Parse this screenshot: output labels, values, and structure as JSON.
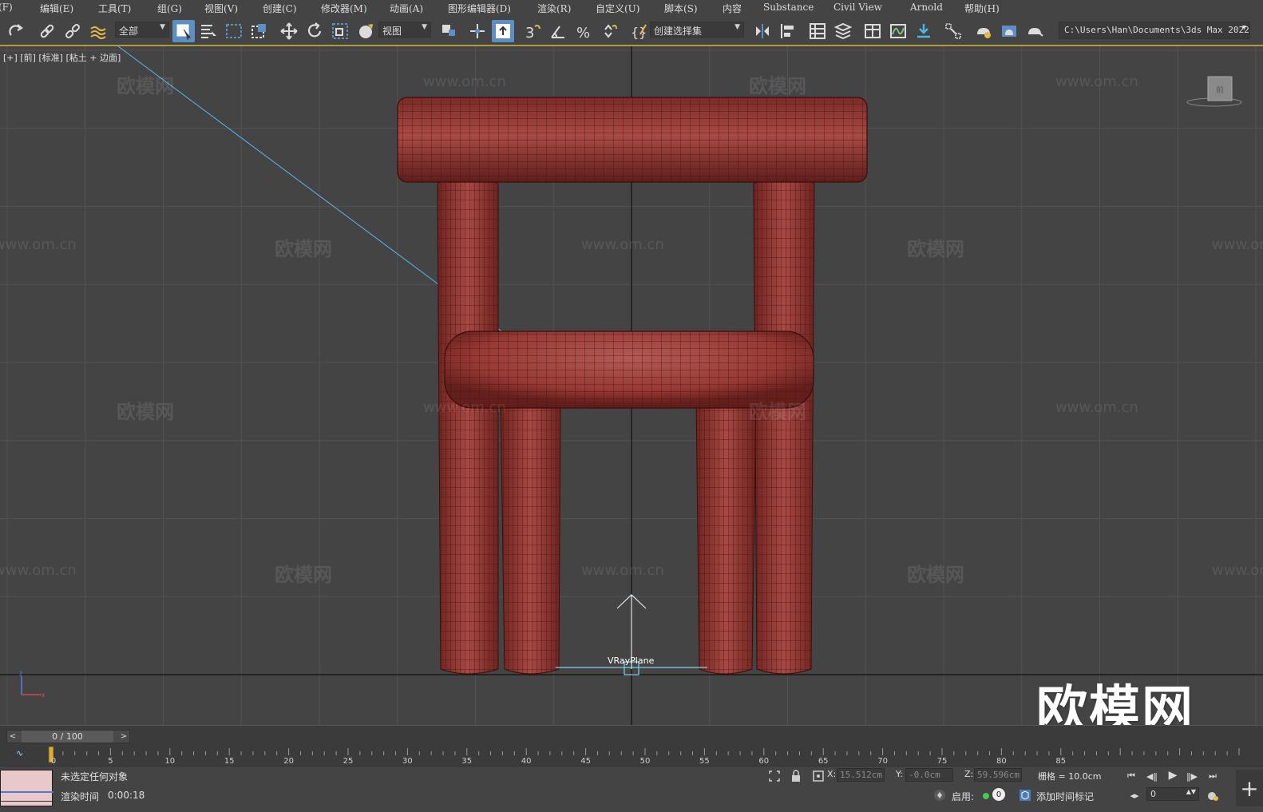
{
  "menu": {
    "items": [
      "(F)",
      "编辑(E)",
      "工具(T)",
      "组(G)",
      "视图(V)",
      "创建(C)",
      "修改器(M)",
      "动画(A)",
      "图形编辑器(D)",
      "渲染(R)",
      "自定义(U)",
      "脚本(S)",
      "内容",
      "Substance",
      "Civil View",
      "Arnold",
      "帮助(H)"
    ]
  },
  "toolbar": {
    "selection_filter": "全部",
    "reference_coord": "视图",
    "named_selection": "创建选择集",
    "project_path": "C:\\Users\\Han\\Documents\\3ds Max 2022",
    "icons": [
      "redo-icon",
      "link-icon",
      "unlink-icon",
      "bind-space-warp-icon",
      "select-object-icon",
      "select-by-name-icon",
      "rect-selection-icon",
      "window-crossing-icon",
      "move-icon",
      "rotate-icon",
      "scale-icon",
      "place-icon",
      "pivot-icon",
      "select-manipulate-icon",
      "keyboard-shortcut-icon",
      "snap-3d-icon",
      "angle-snap-icon",
      "percent-snap-icon",
      "spinner-snap-icon",
      "edit-named-sets-icon",
      "mirror-icon",
      "align-icon",
      "scene-explorer-icon",
      "layer-explorer-icon",
      "ribbon-icon",
      "curve-editor-icon",
      "schematic-view-icon",
      "material-editor-icon",
      "render-setup-icon",
      "rendered-frame-icon",
      "render-production-icon"
    ]
  },
  "viewport": {
    "label": "[+] [前] [标准] [粘土 + 边面]",
    "object_label": "VRayPlane",
    "viewcube_label": "前",
    "watermark_text": "欧模网",
    "watermark_url": "www.om.cn",
    "logo_text": "欧模网",
    "mesh_color": "#9b3a35",
    "background_color": "#444444",
    "grid_color": "#525252"
  },
  "timeline": {
    "frame_display": "0 / 100",
    "current_frame": 0,
    "total_frames": 100,
    "ticks": [
      "0",
      "5",
      "10",
      "15",
      "20",
      "25",
      "30",
      "35",
      "40",
      "45",
      "50",
      "55",
      "60",
      "65",
      "70",
      "75",
      "80",
      "85"
    ]
  },
  "status": {
    "selection_message": "未选定任何对象",
    "render_time_label": "渲染时间",
    "render_time_value": "0:00:18",
    "x_label": "X:",
    "x_value": "15.512cm",
    "y_label": "Y:",
    "y_value": "-0.0cm",
    "z_label": "Z:",
    "z_value": "59.596cm",
    "grid_label": "栅格 = 10.0cm",
    "enable_label": "启用:",
    "enable_count": "0",
    "add_time_tag": "添加时间标记",
    "frame_value": "0"
  }
}
